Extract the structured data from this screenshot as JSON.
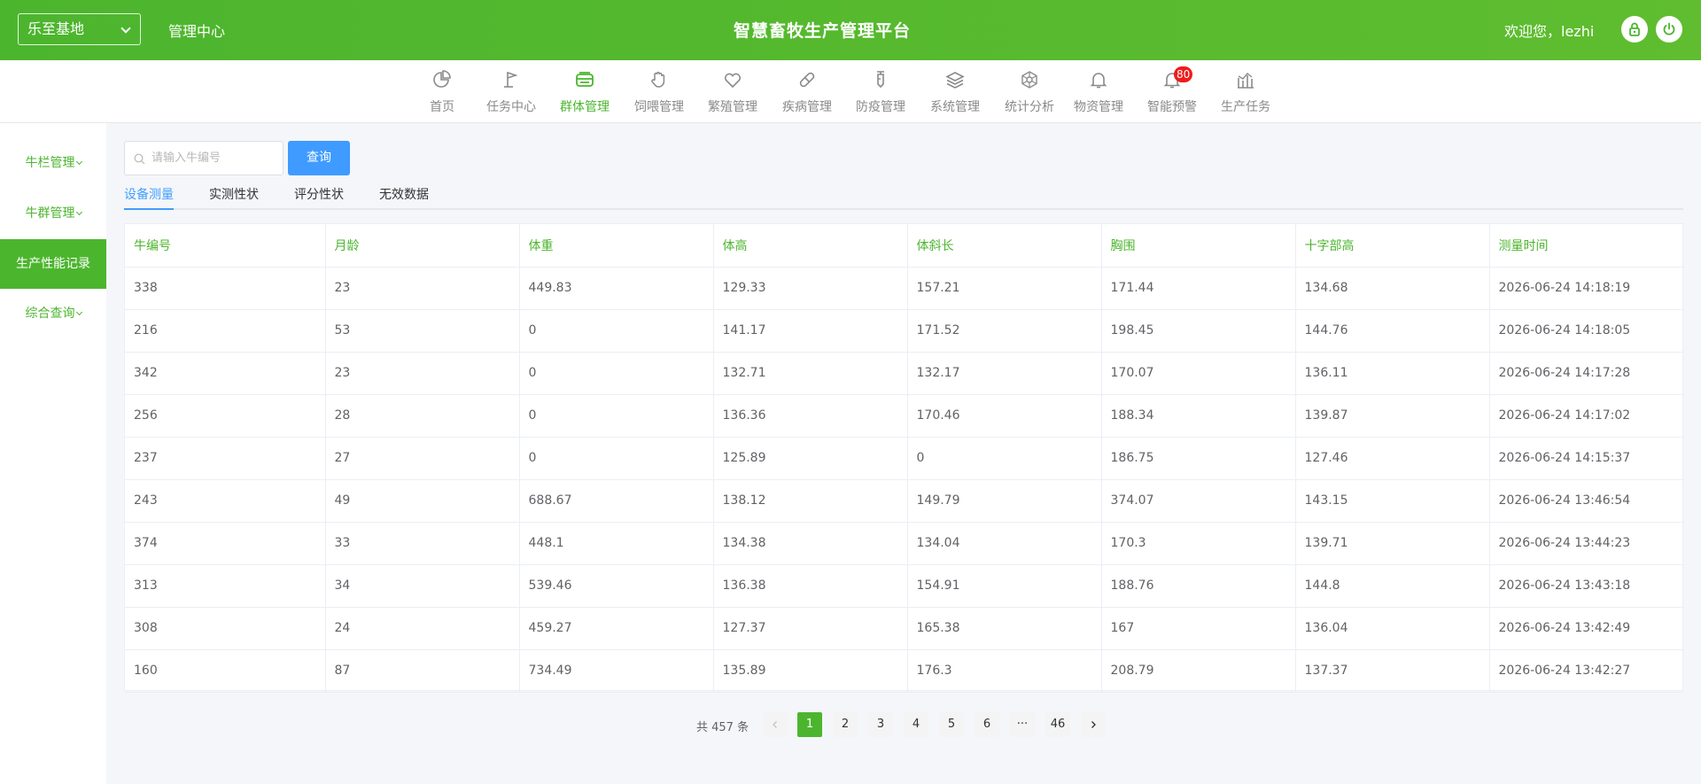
{
  "header": {
    "farm_selector": "乐至基地",
    "mgmt_center": "管理中心",
    "title": "智慧畜牧生产管理平台",
    "welcome": "欢迎您，lezhi"
  },
  "nav": {
    "items": [
      {
        "label": "首页",
        "icon": "pie-chart-icon"
      },
      {
        "label": "任务中心",
        "icon": "flag-icon"
      },
      {
        "label": "群体管理",
        "icon": "herd-icon"
      },
      {
        "label": "饲喂管理",
        "icon": "hand-icon"
      },
      {
        "label": "繁殖管理",
        "icon": "heart-icon"
      },
      {
        "label": "疾病管理",
        "icon": "pill-icon"
      },
      {
        "label": "防疫管理",
        "icon": "syringe-icon"
      },
      {
        "label": "系统管理",
        "icon": "layers-icon"
      },
      {
        "label": "统计分析",
        "icon": "network-icon"
      },
      {
        "label": "物资管理",
        "icon": "bell-icon"
      },
      {
        "label": "智能预警",
        "icon": "alert-bell-icon",
        "badge": "80"
      },
      {
        "label": "生产任务",
        "icon": "bar-chart-icon"
      }
    ],
    "active_index": 2
  },
  "sidebar": {
    "items": [
      {
        "label": "牛栏管理"
      },
      {
        "label": "牛群管理"
      },
      {
        "label": "生产性能记录"
      },
      {
        "label": "综合查询"
      }
    ]
  },
  "search": {
    "placeholder": "请输入牛编号",
    "button": "查询"
  },
  "tabs": [
    "设备测量",
    "实测性状",
    "评分性状",
    "无效数据"
  ],
  "table": {
    "columns": [
      "牛编号",
      "月龄",
      "体重",
      "体高",
      "体斜长",
      "胸围",
      "十字部高",
      "测量时间"
    ],
    "rows": [
      [
        "338",
        "23",
        "449.83",
        "129.33",
        "157.21",
        "171.44",
        "134.68",
        "2026-06-24 14:18:19"
      ],
      [
        "216",
        "53",
        "0",
        "141.17",
        "171.52",
        "198.45",
        "144.76",
        "2026-06-24 14:18:05"
      ],
      [
        "342",
        "23",
        "0",
        "132.71",
        "132.17",
        "170.07",
        "136.11",
        "2026-06-24 14:17:28"
      ],
      [
        "256",
        "28",
        "0",
        "136.36",
        "170.46",
        "188.34",
        "139.87",
        "2026-06-24 14:17:02"
      ],
      [
        "237",
        "27",
        "0",
        "125.89",
        "0",
        "186.75",
        "127.46",
        "2026-06-24 14:15:37"
      ],
      [
        "243",
        "49",
        "688.67",
        "138.12",
        "149.79",
        "374.07",
        "143.15",
        "2026-06-24 13:46:54"
      ],
      [
        "374",
        "33",
        "448.1",
        "134.38",
        "134.04",
        "170.3",
        "139.71",
        "2026-06-24 13:44:23"
      ],
      [
        "313",
        "34",
        "539.46",
        "136.38",
        "154.91",
        "188.76",
        "144.8",
        "2026-06-24 13:43:18"
      ],
      [
        "308",
        "24",
        "459.27",
        "127.37",
        "165.38",
        "167",
        "136.04",
        "2026-06-24 13:42:49"
      ],
      [
        "160",
        "87",
        "734.49",
        "135.89",
        "176.3",
        "208.79",
        "137.37",
        "2026-06-24 13:42:27"
      ]
    ]
  },
  "pagination": {
    "total": "共 457 条",
    "pages": [
      "1",
      "2",
      "3",
      "4",
      "5",
      "6",
      "···",
      "46"
    ],
    "current": "1"
  },
  "colors": {
    "primary": "#4cb52e",
    "button": "#3f9bff",
    "badge": "#f01b1b"
  }
}
